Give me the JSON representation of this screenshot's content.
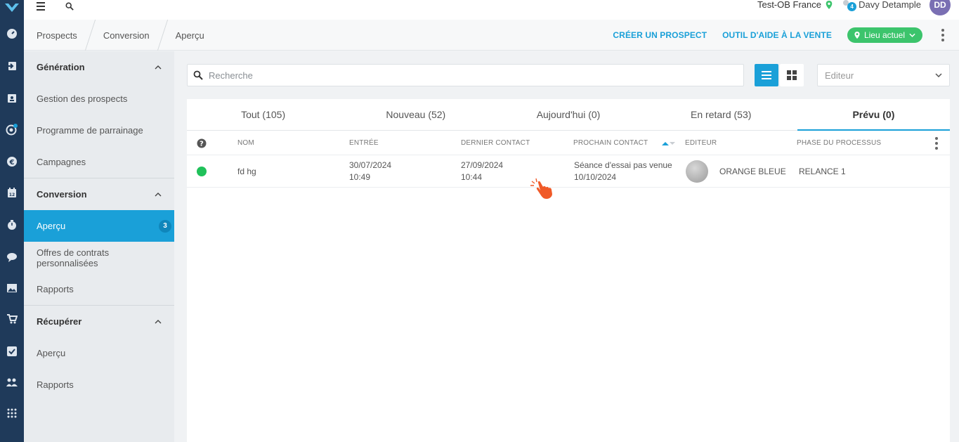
{
  "topbar": {
    "location_name": "Test-OB France",
    "notifications_count": "4",
    "user_name": "Davy Detample",
    "user_initials": "DD"
  },
  "breadcrumb": [
    "Prospects",
    "Conversion",
    "Aperçu"
  ],
  "actions": {
    "create_prospect": "CRÉER UN PROSPECT",
    "sales_tool": "OUTIL D'AIDE À LA VENTE",
    "location_pill": "Lieu actuel"
  },
  "sidebar": {
    "groups": [
      {
        "label": "Génération",
        "items": [
          {
            "label": "Gestion des prospects"
          },
          {
            "label": "Programme de parrainage"
          },
          {
            "label": "Campagnes"
          }
        ]
      },
      {
        "label": "Conversion",
        "items": [
          {
            "label": "Aperçu",
            "badge": "3"
          },
          {
            "label": "Offres de contrats personnalisées"
          },
          {
            "label": "Rapports"
          }
        ]
      },
      {
        "label": "Récupérer",
        "items": [
          {
            "label": "Aperçu"
          },
          {
            "label": "Rapports"
          }
        ]
      }
    ]
  },
  "search": {
    "placeholder": "Recherche"
  },
  "editor_filter": {
    "placeholder": "Editeur"
  },
  "tabs": [
    {
      "label": "Tout (105)"
    },
    {
      "label": "Nouveau (52)"
    },
    {
      "label": "Aujourd'hui (0)"
    },
    {
      "label": "En retard (53)"
    },
    {
      "label": "Prévu (0)"
    }
  ],
  "table": {
    "headers": {
      "name": "NOM",
      "entry": "ENTRÉE",
      "last_contact": "DERNIER CONTACT",
      "next_contact": "PROCHAIN CONTACT",
      "editor": "EDITEUR",
      "phase": "PHASE DU PROCESSUS"
    },
    "rows": [
      {
        "name": "fd hg",
        "entry_date": "30/07/2024",
        "entry_time": "10:49",
        "last_contact_date": "27/09/2024",
        "last_contact_time": "10:44",
        "next_contact_title": "Séance d'essai pas venue",
        "next_contact_date": "10/10/2024",
        "editor": "ORANGE BLEUE",
        "phase": "RELANCE 1",
        "status_color": "#20c15a"
      }
    ]
  },
  "colors": {
    "accent": "#1aa0d8",
    "rail": "#1f3a5a",
    "location_pill": "#3cc46c",
    "status_green": "#20c15a"
  },
  "icons": {
    "rail": [
      "logo-icon",
      "dashboard-icon",
      "login-icon",
      "contacts-icon",
      "target-icon",
      "euro-icon",
      "calendar-icon",
      "timer-icon",
      "chat-icon",
      "image-icon",
      "cart-icon",
      "checkbox-icon",
      "users-icon",
      "grid-dots-icon"
    ]
  }
}
